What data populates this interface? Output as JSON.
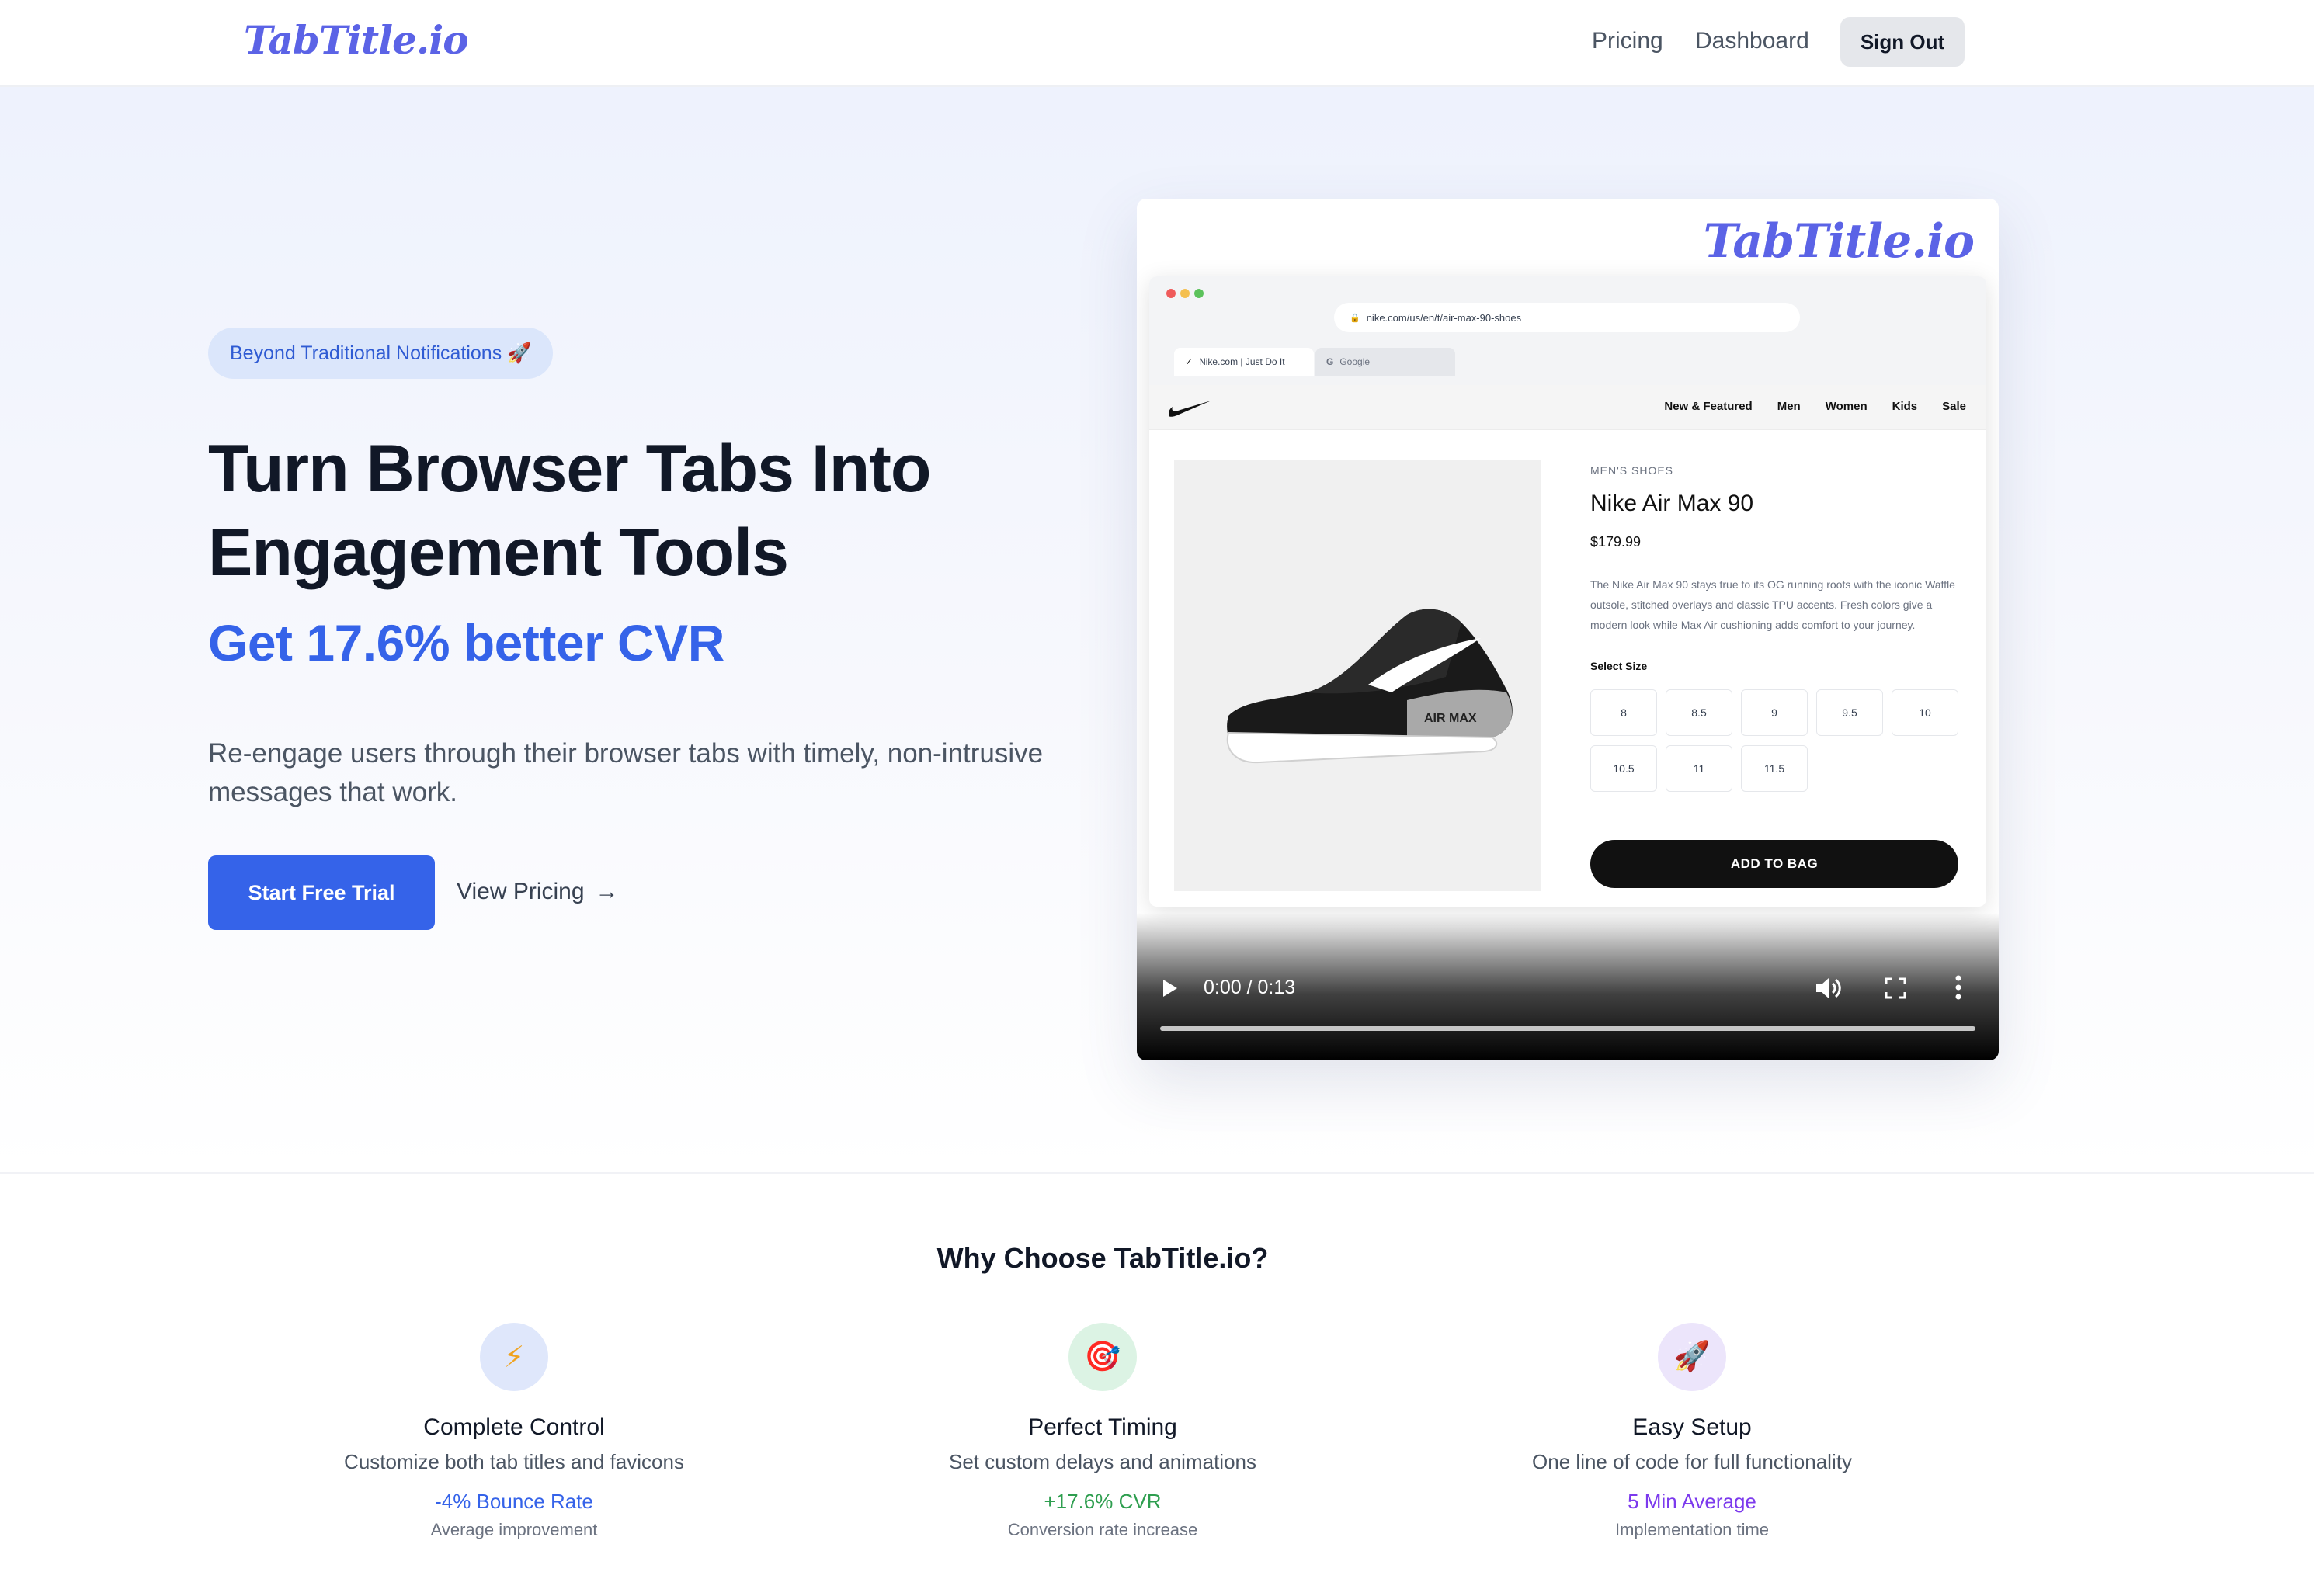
{
  "nav": {
    "logo": "TabTitle.io",
    "links": [
      "Pricing",
      "Dashboard"
    ],
    "sign_out": "Sign Out"
  },
  "hero": {
    "badge": "Beyond Traditional Notifications 🚀",
    "headline_line1": "Turn Browser Tabs Into",
    "headline_line2": "Engagement Tools",
    "subhead": "Get 17.6% better CVR",
    "description": "Re-engage users through their browser tabs with timely, non-intrusive messages that work.",
    "primary_cta": "Start Free Trial",
    "secondary_cta": "View Pricing",
    "arrow": "→"
  },
  "video": {
    "watermark": "TabTitle.io",
    "browser": {
      "url": "nike.com/us/en/t/air-max-90-shoes",
      "tabs": [
        "Nike.com | Just Do It",
        "Google"
      ],
      "site_nav": [
        "New & Featured",
        "Men",
        "Women",
        "Kids",
        "Sale"
      ],
      "product": {
        "category": "MEN'S SHOES",
        "name": "Nike Air Max 90",
        "price": "$179.99",
        "description": "The Nike Air Max 90 stays true to its OG running roots with the iconic Waffle outsole, stitched overlays and classic TPU accents. Fresh colors give a modern look while Max Air cushioning adds comfort to your journey.",
        "size_label": "Select Size",
        "sizes": [
          "8",
          "8.5",
          "9",
          "9.5",
          "10",
          "10.5",
          "11",
          "11.5"
        ],
        "add_to_bag": "ADD TO BAG"
      }
    },
    "time": "0:00 / 0:13",
    "progress": 0
  },
  "why": {
    "title": "Why Choose TabTitle.io?",
    "features": [
      {
        "icon": "⚡",
        "icon_name": "lightning-icon",
        "title": "Complete Control",
        "desc": "Customize both tab titles and favicons",
        "metric": "-4% Bounce Rate",
        "sub": "Average improvement"
      },
      {
        "icon": "🎯",
        "icon_name": "target-icon",
        "title": "Perfect Timing",
        "desc": "Set custom delays and animations",
        "metric": "+17.6% CVR",
        "sub": "Conversion rate increase"
      },
      {
        "icon": "🚀",
        "icon_name": "rocket-icon",
        "title": "Easy Setup",
        "desc": "One line of code for full functionality",
        "metric": "5 Min Average",
        "sub": "Implementation time"
      }
    ]
  },
  "colors": {
    "primary": "#3563e9",
    "logo": "#5b63e6",
    "green": "#2e9e4f",
    "purple": "#7c3aed"
  }
}
